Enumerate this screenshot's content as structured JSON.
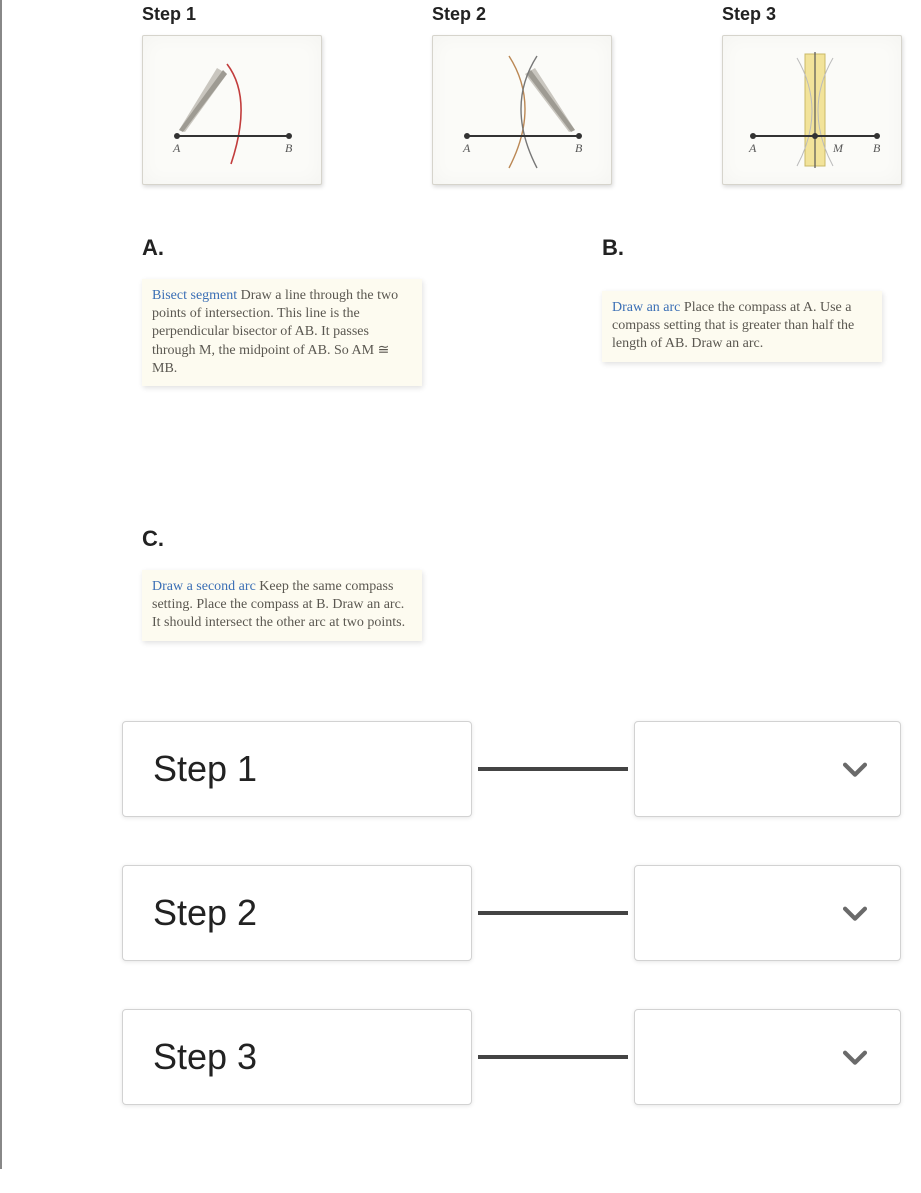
{
  "steps_row": {
    "headers": [
      "Step 1",
      "Step 2",
      "Step 3"
    ],
    "point_labels": {
      "A": "A",
      "B": "B",
      "M": "M"
    }
  },
  "options": {
    "A": {
      "letter": "A.",
      "lead": "Bisect segment",
      "body": " Draw a line through the two points of intersection. This line is the perpendicular bisector of AB. It passes through M, the midpoint of AB. So AM ≅ MB."
    },
    "B": {
      "letter": "B.",
      "lead": "Draw an arc",
      "body": " Place the compass at A. Use a compass setting that is greater than half the length of AB. Draw an arc."
    },
    "C": {
      "letter": "C.",
      "lead": "Draw a second arc",
      "body": " Keep the same compass setting. Place the compass at B. Draw an arc. It should intersect the other arc at two points."
    }
  },
  "match": {
    "rows": [
      {
        "label": "Step 1"
      },
      {
        "label": "Step 2"
      },
      {
        "label": "Step 3"
      }
    ]
  }
}
